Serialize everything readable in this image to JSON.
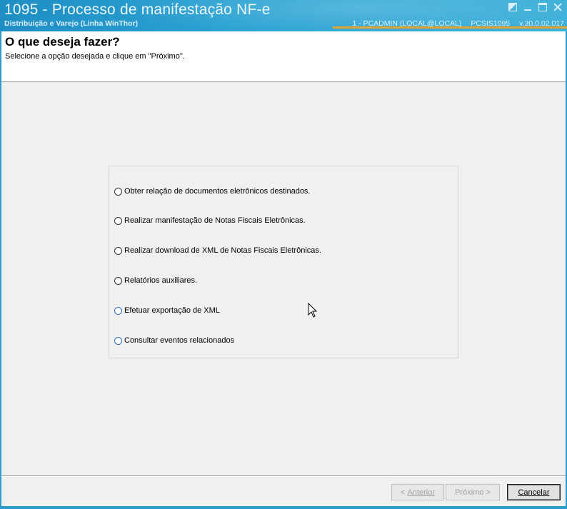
{
  "window": {
    "title": "1095 - Processo de manifestação NF-e",
    "subtitle": "Distribuição e Varejo (Linha WinThor)",
    "user": "1 - PCADMIN (LOCAL@LOCAL)",
    "routine": "PCSIS1095",
    "version": "v.30.0.02.017",
    "accent_color": "#2a9bcc",
    "status_line_color": "#e7a32a"
  },
  "header": {
    "title": "O que deseja fazer?",
    "subtitle": "Selecione a opção desejada e clique em \"Próximo\"."
  },
  "options": [
    {
      "label": "Obter relação de documentos eletrônicos destinados.",
      "selected": false
    },
    {
      "label": "Realizar manifestação de Notas Fiscais Eletrônicas.",
      "selected": false
    },
    {
      "label": "Realizar download de XML de Notas Fiscais Eletrônicas.",
      "selected": false
    },
    {
      "label": "Relatórios auxiliares.",
      "selected": false
    },
    {
      "label": "Efetuar exportação de XML",
      "selected": false
    },
    {
      "label": "Consultar eventos relacionados",
      "selected": false
    }
  ],
  "buttons": {
    "back_prefix": "< ",
    "back_label": "Anterior",
    "next_label": "Próximo",
    "next_suffix": " >",
    "cancel_label": "Cancelar"
  }
}
